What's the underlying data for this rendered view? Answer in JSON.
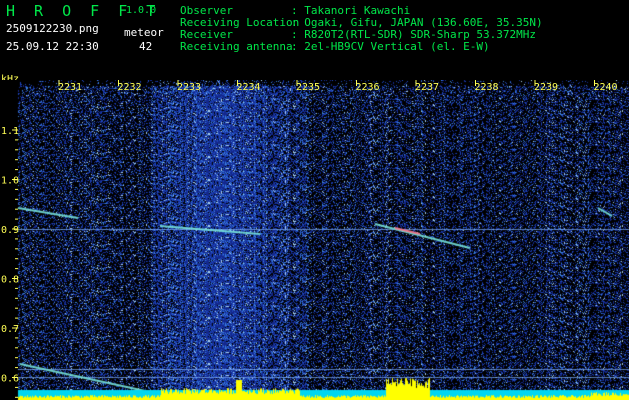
{
  "app": {
    "name": "H R O F F T",
    "version": "1.0.0"
  },
  "file": {
    "name": "2509122230.png",
    "datetime": "25.09.12 22:30"
  },
  "counter": {
    "label": "meteor",
    "value": "42"
  },
  "info": [
    {
      "label": "Observer",
      "value": ": Takanori Kawachi"
    },
    {
      "label": "Receiving Location",
      "value": ": Ogaki, Gifu, JAPAN (136.60E, 35.35N)"
    },
    {
      "label": "Receiver",
      "value": ": R820T2(RTL-SDR) SDR-Sharp 53.372MHz"
    },
    {
      "label": "Receiving antenna",
      "value": ": 2el-HB9CV Vertical (el. E-W)"
    }
  ],
  "axis": {
    "unit": "kHz",
    "time_ticks": [
      "2231",
      "2232",
      "2233",
      "2234",
      "2235",
      "2236",
      "2237",
      "2238",
      "2239",
      "2240"
    ],
    "freq_ticks": [
      "1.1",
      "1.0",
      "0.9",
      "0.8",
      "0.7",
      "0.6"
    ]
  },
  "colors": {
    "background": "#000000",
    "text_green": "#00e84a",
    "text_yellow": "#ffff55",
    "noise": "#1b2f7e",
    "signal": "#ffffff"
  }
}
